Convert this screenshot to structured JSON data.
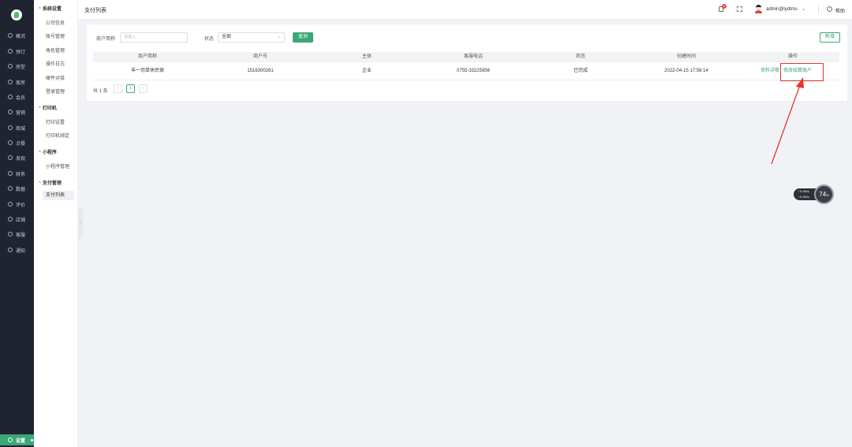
{
  "nav": {
    "items": [
      {
        "label": "概况",
        "icon": "dashboard-icon"
      },
      {
        "label": "预订",
        "icon": "calendar-icon"
      },
      {
        "label": "房型",
        "icon": "house-icon"
      },
      {
        "label": "客房",
        "icon": "bell-icon"
      },
      {
        "label": "会员",
        "icon": "member-icon"
      },
      {
        "label": "营销",
        "icon": "megaphone-icon"
      },
      {
        "label": "商城",
        "icon": "shop-icon"
      },
      {
        "label": "点餐",
        "icon": "dining-icon"
      },
      {
        "label": "发现",
        "icon": "compass-icon"
      },
      {
        "label": "财务",
        "icon": "finance-icon"
      },
      {
        "label": "数据",
        "icon": "data-icon"
      },
      {
        "label": "评价",
        "icon": "star-icon"
      },
      {
        "label": "店铺",
        "icon": "store-icon"
      },
      {
        "label": "客服",
        "icon": "service-icon"
      },
      {
        "label": "通知",
        "icon": "mail-icon"
      }
    ],
    "active": {
      "label": "设置",
      "icon": "gear-icon"
    }
  },
  "submenu": {
    "groups": [
      {
        "title": "系统设置",
        "items": [
          "公司信息",
          "账号管理",
          "角色管理",
          "操作日志",
          "硬件对接",
          "登录管理"
        ]
      },
      {
        "title": "打印机",
        "items": [
          "打印设置",
          "打印机绑定"
        ]
      },
      {
        "title": "小程序",
        "items": [
          "小程序管理"
        ]
      },
      {
        "title": "支付管理",
        "items": [
          "支付列表"
        ]
      }
    ],
    "collapse_glyph": "‹"
  },
  "header": {
    "title": "支付列表",
    "notification_count": "3",
    "user": "admin@lydtms",
    "help": "帮助"
  },
  "filters": {
    "merchant_label": "商户简称",
    "merchant_placeholder": "请输入",
    "status_label": "状态",
    "status_value": "全部",
    "query_button": "查询",
    "new_button": "新增"
  },
  "table": {
    "columns": [
      "商户简称",
      "商户号",
      "主体",
      "客服电话",
      "状态",
      "创建时间",
      "操作"
    ],
    "rows": [
      {
        "merchant": "丰一司单休民宿",
        "merchant_no": "1516300261",
        "entity": "企业",
        "phone": "0755-33225956",
        "status": "已完成",
        "created": "2022-04-15 17:56:14",
        "actions": [
          "资料详情",
          "修改结算账户"
        ]
      }
    ]
  },
  "pagination": {
    "total": "共 1 条",
    "prev": "‹",
    "page": "1",
    "next": "›"
  },
  "widget": {
    "upload": "0.4",
    "download": "0.2",
    "unit": "K/s",
    "percent": "74",
    "percent_unit": "%"
  },
  "colors": {
    "accent": "#3aa776",
    "nav_bg": "#1f2430",
    "highlight": "#e8352a"
  }
}
